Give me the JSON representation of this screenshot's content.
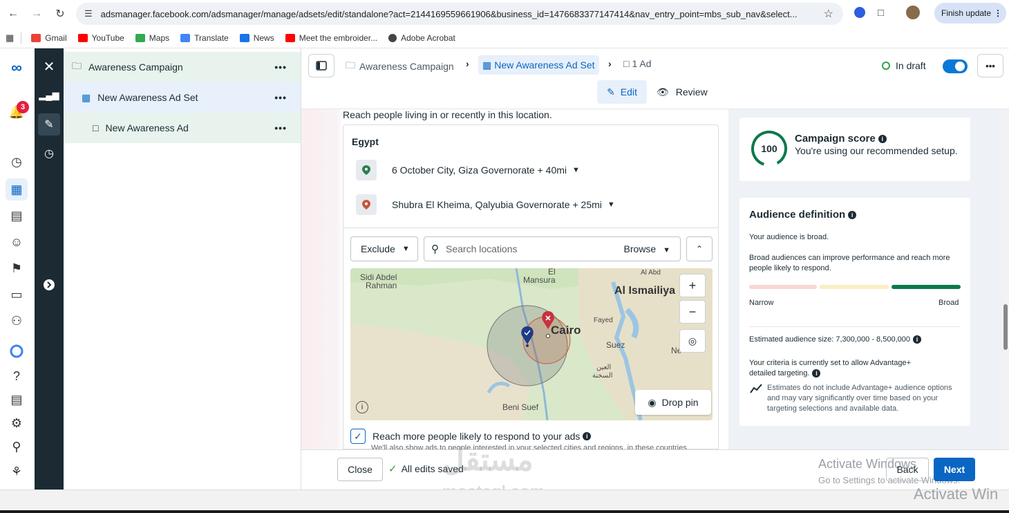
{
  "browser": {
    "url": "adsmanager.facebook.com/adsmanager/manage/adsets/edit/standalone?act=2144169559661906&business_id=1476683377147414&nav_entry_point=mbs_sub_nav&select...",
    "finish_update": "Finish update",
    "bookmarks": [
      {
        "label": "Gmail",
        "color": "#ea4335"
      },
      {
        "label": "YouTube",
        "color": "#ff0000"
      },
      {
        "label": "Maps",
        "color": "#34a853"
      },
      {
        "label": "Translate",
        "color": "#4285f4"
      },
      {
        "label": "News",
        "color": "#1a73e8"
      },
      {
        "label": "Meet the embroider...",
        "color": "#ff0000"
      },
      {
        "label": "Adobe Acrobat",
        "color": "#444444"
      }
    ]
  },
  "rail": {
    "notification_count": "3"
  },
  "tree": {
    "campaign": "Awareness Campaign",
    "adset": "New Awareness Ad Set",
    "ad": "New Awareness Ad",
    "more": "•••"
  },
  "header": {
    "crumb_campaign": "Awareness Campaign",
    "crumb_adset": "New Awareness Ad Set",
    "crumb_ad": "1 Ad",
    "status": "In draft",
    "edit_tab": "Edit",
    "review_tab": "Review",
    "more": "•••"
  },
  "location": {
    "intro": "Reach people living in or recently in this location.",
    "country": "Egypt",
    "items": [
      {
        "label": "6 October City, Giza Governorate + 40mi",
        "pin_color": "#2e7d4f"
      },
      {
        "label": "Shubra El Kheima, Qalyubia Governorate + 25mi",
        "pin_color": "#c2573a"
      }
    ],
    "exclude_label": "Exclude",
    "search_placeholder": "Search locations",
    "browse_label": "Browse",
    "drop_pin": "Drop pin",
    "reach_more": "Reach more people likely to respond to your ads",
    "reach_sub": "We'll also show ads to people interested in your selected cities and regions, in these countries"
  },
  "map": {
    "labels": {
      "sidi": "Sidi Abdel",
      "rahman": "Rahman",
      "el": "El",
      "mansura": "Mansura",
      "ismailiya": "Al Ismailiya",
      "al_abd": "Al Abd",
      "fayed": "Fayed",
      "cairo": "Cairo",
      "suez": "Suez",
      "ne": "Ne",
      "sokhna": "العين",
      "sokhna2": "السخنة",
      "beni_suef": "Beni Suef"
    }
  },
  "score": {
    "value": "100",
    "title": "Campaign score",
    "subtitle": "You're using our recommended setup."
  },
  "audience": {
    "title": "Audience definition",
    "broad_text": "Your audience is broad.",
    "improve_text": "Broad audiences can improve performance and reach more people likely to respond.",
    "narrow": "Narrow",
    "broad": "Broad",
    "size": "Estimated audience size: 7,300,000 - 8,500,000",
    "criteria": "Your criteria is currently set to allow Advantage+ detailed targeting.",
    "estimates": "Estimates do not include Advantage+ audience options and may vary significantly over time based on your targeting selections and available data."
  },
  "footer": {
    "close": "Close",
    "saved": "All edits saved",
    "back": "Back",
    "next": "Next",
    "activate": "Activate Windows",
    "activate_sub": "Go to Settings to activate Windows.",
    "activate2": "Activate Win"
  },
  "watermark": {
    "arabic": "مستقل",
    "latin": "mostaql.com"
  },
  "colors": {
    "primary": "#0a66c2",
    "dark_panel": "#1c2b33",
    "success": "#31a24c"
  }
}
